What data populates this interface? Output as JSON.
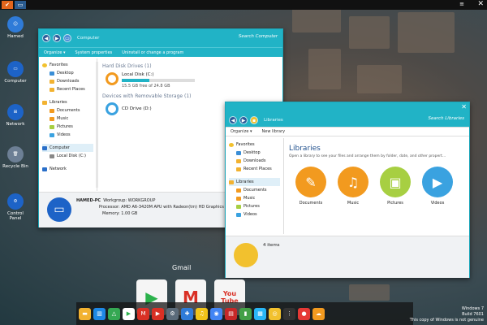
{
  "desktop_icons": [
    {
      "label": "Hamed",
      "color": "#2f7bd8",
      "glyph": "☺"
    },
    {
      "label": "Computer",
      "color": "#1d63c7",
      "glyph": "▭"
    },
    {
      "label": "Network",
      "color": "#1d63c7",
      "glyph": "⊞"
    },
    {
      "label": "Recycle Bin",
      "color": "#6d7f95",
      "glyph": "🗑"
    },
    {
      "label": "Control Panel",
      "color": "#1d63c7",
      "glyph": "⚙"
    }
  ],
  "computer_window": {
    "address": "Computer",
    "search_placeholder": "Search Computer",
    "toolbar": [
      "Organize ▾",
      "System properties",
      "Uninstall or change a program"
    ],
    "nav": {
      "favorites": "Favorites",
      "favorites_items": [
        "Desktop",
        "Downloads",
        "Recent Places"
      ],
      "libraries": "Libraries",
      "libraries_items": [
        "Documents",
        "Music",
        "Pictures",
        "Videos"
      ],
      "computer": "Computer",
      "computer_items": [
        "Local Disk (C:)"
      ],
      "network": "Network"
    },
    "hdd_header": "Hard Disk Drives (1)",
    "local_disk": {
      "name": "Local Disk (C:)",
      "free": "15.5 GB free of 24.8 GB",
      "used_fraction": 0.375
    },
    "removable_header": "Devices with Removable Storage (1)",
    "cd_drive": "CD Drive (D:)",
    "details": {
      "pc_name": "HAMED-PC",
      "workgroup_label": "Workgroup:",
      "workgroup": "WORKGROUP",
      "processor_label": "Processor:",
      "processor": "AMD A6-3420M APU with Radeon(tm) HD Graphics",
      "memory_label": "Memory:",
      "memory": "1.00 GB"
    }
  },
  "libraries_window": {
    "address": "Libraries",
    "search_placeholder": "Search Libraries",
    "toolbar": [
      "Organize ▾",
      "New library"
    ],
    "nav": {
      "favorites": "Favorites",
      "favorites_items": [
        "Desktop",
        "Downloads",
        "Recent Places"
      ],
      "libraries": "Libraries",
      "libraries_items": [
        "Documents",
        "Music",
        "Pictures",
        "Videos"
      ]
    },
    "title": "Libraries",
    "subtitle": "Open a library to see your files and arrange them by folder, date, and other propert...",
    "libs": [
      {
        "label": "Documents",
        "color": "#f29a1f",
        "glyph": "✎"
      },
      {
        "label": "Music",
        "color": "#f29a1f",
        "glyph": "♫"
      },
      {
        "label": "Pictures",
        "color": "#a7cf42",
        "glyph": "▣"
      },
      {
        "label": "Videos",
        "color": "#3aa2e0",
        "glyph": "▶"
      }
    ],
    "status": "4 items"
  },
  "dock_label": "Gmail",
  "big_apps": [
    {
      "name": "play-store",
      "color": "#f5f5f5",
      "glyph": "▶",
      "fg": "#2bb24c"
    },
    {
      "name": "gmail",
      "color": "#f5f5f5",
      "glyph": "M",
      "fg": "#d93025"
    },
    {
      "name": "youtube",
      "color": "#f5f5f5",
      "glyph": "You\nTube",
      "fg": "#d93025"
    }
  ],
  "dock": [
    {
      "color": "#f2b230",
      "g": "▬"
    },
    {
      "color": "#1e88e5",
      "g": "▥"
    },
    {
      "color": "#35a853",
      "g": "△"
    },
    {
      "color": "#ffffff",
      "g": "▶"
    },
    {
      "color": "#d93025",
      "g": "M"
    },
    {
      "color": "#d93025",
      "g": "▶"
    },
    {
      "color": "#5b6b7a",
      "g": "⚙"
    },
    {
      "color": "#2f7bd8",
      "g": "✚"
    },
    {
      "color": "#f0c419",
      "g": "♫"
    },
    {
      "color": "#4285f4",
      "g": "◉"
    },
    {
      "color": "#c62828",
      "g": "▤"
    },
    {
      "color": "#43a047",
      "g": "▮"
    },
    {
      "color": "#29b6f6",
      "g": "▦"
    },
    {
      "color": "#f2c12e",
      "g": "◎"
    },
    {
      "color": "#333333",
      "g": "⋮"
    },
    {
      "color": "#e53935",
      "g": "●"
    },
    {
      "color": "#f29a1f",
      "g": "☁"
    }
  ],
  "watermark": {
    "line1": "Windows 7",
    "line2": "Build 7601",
    "line3": "This copy of Windows is not genuine"
  },
  "topbar": {
    "time": "≡"
  }
}
